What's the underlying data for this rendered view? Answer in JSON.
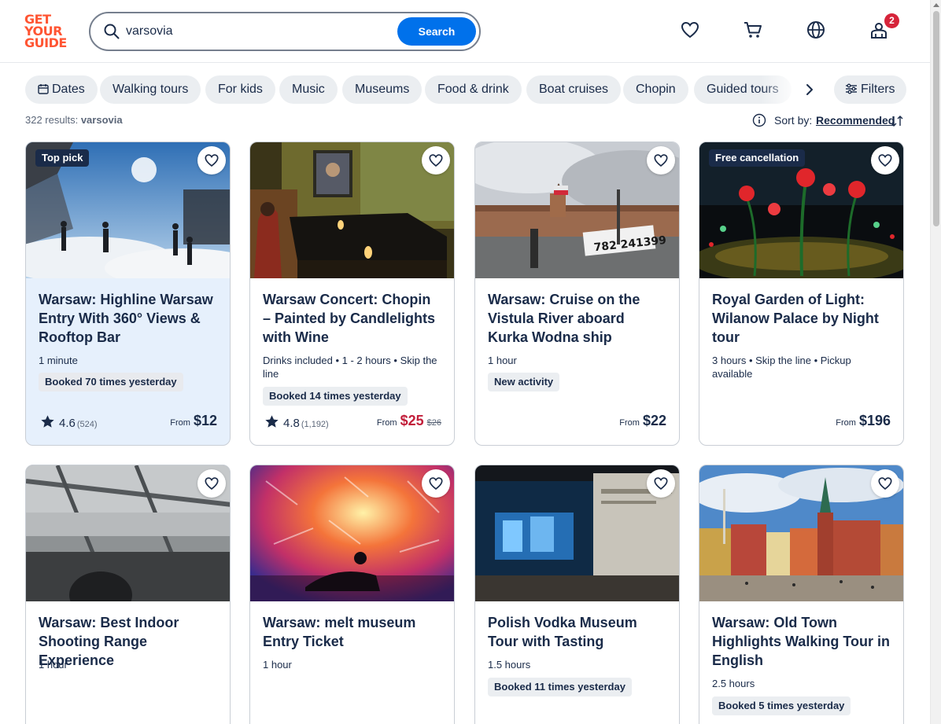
{
  "header": {
    "logo_lines": [
      "GET",
      "YOUR",
      "GUIDE"
    ],
    "search_value": "varsovia",
    "search_button": "Search",
    "cart_badge": "2",
    "icons": [
      "heart-icon",
      "cart-icon",
      "globe-icon",
      "profile-icon"
    ]
  },
  "filters": {
    "chips": [
      "Dates",
      "Walking tours",
      "For kids",
      "Music",
      "Museums",
      "Food & drink",
      "Boat cruises",
      "Chopin",
      "Guided tours"
    ],
    "filters_button": "Filters"
  },
  "results": {
    "count_prefix": "322 results:",
    "query": "varsovia",
    "sort_label": "Sort by:",
    "sort_value": "Recommended"
  },
  "cards": [
    {
      "tag": "Top pick",
      "title": "Warsaw: Highline Warsaw Entry With 360° Views & Rooftop Bar",
      "meta": "1 minute",
      "pill": "Booked 70 times yesterday",
      "rating": "4.6",
      "reviews": "(524)",
      "from": "From",
      "price": "$12"
    },
    {
      "title": "Warsaw Concert: Chopin – Painted by Candlelights with Wine",
      "meta": "Drinks included • 1 - 2 hours • Skip the line",
      "pill": "Booked 14 times yesterday",
      "rating": "4.8",
      "reviews": "(1,192)",
      "from": "From",
      "price": "$25",
      "old_price": "$26"
    },
    {
      "title": "Warsaw: Cruise on the Vistula River aboard Kurka Wodna ship",
      "meta": "1 hour",
      "pill": "New activity",
      "from": "From",
      "price": "$22"
    },
    {
      "tag": "Free cancellation",
      "title": "Royal Garden of Light: Wilanow Palace by Night tour",
      "meta": "3 hours • Skip the line • Pickup available",
      "from": "From",
      "price": "$196"
    },
    {
      "title": "Warsaw: Best Indoor Shooting Range Experience",
      "meta": "1 hour"
    },
    {
      "title": "Warsaw: melt museum Entry Ticket",
      "meta": "1 hour"
    },
    {
      "title": "Polish Vodka Museum Tour with Tasting",
      "meta": "1.5 hours",
      "pill": "Booked 11 times yesterday"
    },
    {
      "title": "Warsaw: Old Town Highlights Walking Tour in English",
      "meta": "2.5 hours",
      "pill": "Booked 5 times yesterday"
    }
  ],
  "colors": {
    "brand": "#ff5533",
    "primary": "#0071eb",
    "navy": "#1a2b49",
    "sale_red": "#c21e3a",
    "chip_bg": "#ebeef1",
    "highlight_card": "#e6f0fc"
  }
}
